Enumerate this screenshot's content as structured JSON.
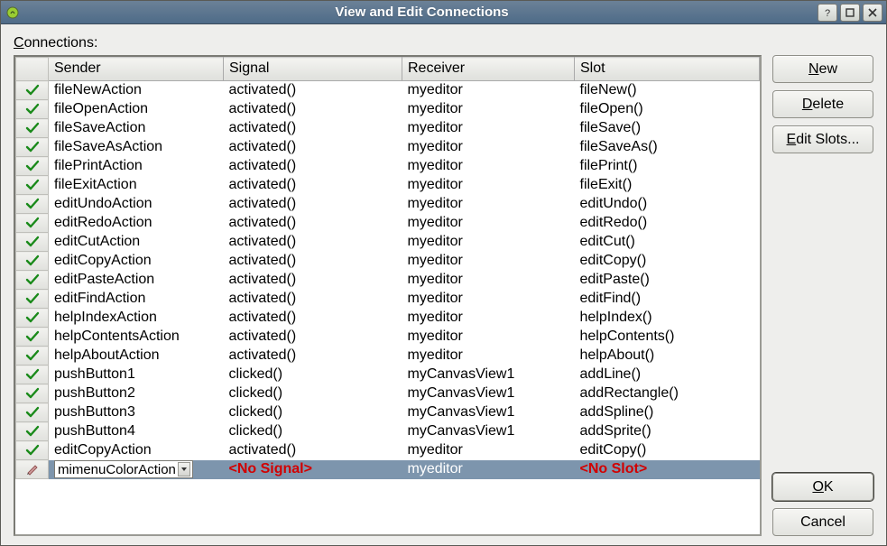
{
  "window": {
    "title": "View and Edit Connections"
  },
  "labels": {
    "connections": "onnections:"
  },
  "table": {
    "headers": {
      "sender": "Sender",
      "signal": "Signal",
      "receiver": "Receiver",
      "slot": "Slot"
    },
    "rows": [
      {
        "ok": true,
        "sender": "fileNewAction",
        "signal": "activated()",
        "receiver": "myeditor",
        "slot": "fileNew()"
      },
      {
        "ok": true,
        "sender": "fileOpenAction",
        "signal": "activated()",
        "receiver": "myeditor",
        "slot": "fileOpen()"
      },
      {
        "ok": true,
        "sender": "fileSaveAction",
        "signal": "activated()",
        "receiver": "myeditor",
        "slot": "fileSave()"
      },
      {
        "ok": true,
        "sender": "fileSaveAsAction",
        "signal": "activated()",
        "receiver": "myeditor",
        "slot": "fileSaveAs()"
      },
      {
        "ok": true,
        "sender": "filePrintAction",
        "signal": "activated()",
        "receiver": "myeditor",
        "slot": "filePrint()"
      },
      {
        "ok": true,
        "sender": "fileExitAction",
        "signal": "activated()",
        "receiver": "myeditor",
        "slot": "fileExit()"
      },
      {
        "ok": true,
        "sender": "editUndoAction",
        "signal": "activated()",
        "receiver": "myeditor",
        "slot": "editUndo()"
      },
      {
        "ok": true,
        "sender": "editRedoAction",
        "signal": "activated()",
        "receiver": "myeditor",
        "slot": "editRedo()"
      },
      {
        "ok": true,
        "sender": "editCutAction",
        "signal": "activated()",
        "receiver": "myeditor",
        "slot": "editCut()"
      },
      {
        "ok": true,
        "sender": "editCopyAction",
        "signal": "activated()",
        "receiver": "myeditor",
        "slot": "editCopy()"
      },
      {
        "ok": true,
        "sender": "editPasteAction",
        "signal": "activated()",
        "receiver": "myeditor",
        "slot": "editPaste()"
      },
      {
        "ok": true,
        "sender": "editFindAction",
        "signal": "activated()",
        "receiver": "myeditor",
        "slot": "editFind()"
      },
      {
        "ok": true,
        "sender": "helpIndexAction",
        "signal": "activated()",
        "receiver": "myeditor",
        "slot": "helpIndex()"
      },
      {
        "ok": true,
        "sender": "helpContentsAction",
        "signal": "activated()",
        "receiver": "myeditor",
        "slot": "helpContents()"
      },
      {
        "ok": true,
        "sender": "helpAboutAction",
        "signal": "activated()",
        "receiver": "myeditor",
        "slot": "helpAbout()"
      },
      {
        "ok": true,
        "sender": "pushButton1",
        "signal": "clicked()",
        "receiver": "myCanvasView1",
        "slot": "addLine()"
      },
      {
        "ok": true,
        "sender": "pushButton2",
        "signal": "clicked()",
        "receiver": "myCanvasView1",
        "slot": "addRectangle()"
      },
      {
        "ok": true,
        "sender": "pushButton3",
        "signal": "clicked()",
        "receiver": "myCanvasView1",
        "slot": "addSpline()"
      },
      {
        "ok": true,
        "sender": "pushButton4",
        "signal": "clicked()",
        "receiver": "myCanvasView1",
        "slot": "addSprite()"
      },
      {
        "ok": true,
        "sender": "editCopyAction",
        "signal": "activated()",
        "receiver": "myeditor",
        "slot": "editCopy()"
      },
      {
        "ok": false,
        "sender": "mimenuColorAction",
        "signal": "<No Signal>",
        "receiver": "myeditor",
        "slot": "<No Slot>",
        "editing": true,
        "selected": true
      }
    ]
  },
  "buttons": {
    "new": "ew",
    "delete": "elete",
    "editSlots": "dit Slots...",
    "ok": "K",
    "cancel": "Cancel"
  }
}
